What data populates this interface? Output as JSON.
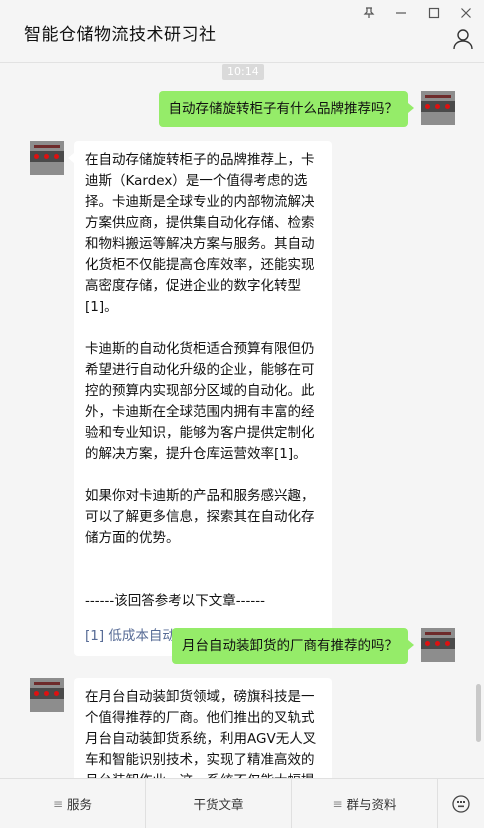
{
  "window": {
    "title": "智能仓储物流技术研习社",
    "pin_glyph": "⊥",
    "minimize_glyph": "—",
    "maximize_glyph": "☐",
    "close_glyph": "✕"
  },
  "chat": {
    "timestamp": "10:14",
    "messages": [
      {
        "role": "user",
        "text": "自动存储旋转柜子有什么品牌推荐吗？"
      },
      {
        "role": "bot",
        "paragraphs": [
          "在自动存储旋转柜子的品牌推荐上，卡迪斯（Kardex）是一个值得考虑的选择。卡迪斯是全球专业的内部物流解决方案供应商，提供集自动化存储、检索和物料搬运等解决方案与服务。其自动化货柜不仅能提高仓库效率，还能实现高密度存储，促进企业的数字化转型[1]。",
          "卡迪斯的自动化货柜适合预算有限但仍希望进行自动化升级的企业，能够在可控的预算内实现部分区域的自动化。此外，卡迪斯在全球范围内拥有丰富的经验和专业知识，能够为客户提供定制化的解决方案，提升仓库运营效率[1]。",
          "如果你对卡迪斯的产品和服务感兴趣，可以了解更多信息，探索其在自动化存储方面的优势。"
        ],
        "ref_header": "------该回答参考以下文章------",
        "ref_link": "[1] 低成本自动化：仓库升..."
      },
      {
        "role": "user",
        "text": "月台自动装卸货的厂商有推荐的吗？"
      },
      {
        "role": "bot",
        "paragraphs": [
          "在月台自动装卸货领域，磅旗科技是一个值得推荐的厂商。他们推出的叉轨式月台自动装卸货系统，利用AGV无人叉车和智能识别技术，实现了精准高效的月台装卸作业。这一系统不仅能大幅提"
        ]
      }
    ]
  },
  "menu": {
    "items": [
      {
        "label": "服务",
        "has_menu_icon": true
      },
      {
        "label": "干货文章",
        "has_menu_icon": false
      },
      {
        "label": "群与资料",
        "has_menu_icon": true
      }
    ],
    "keyboard_icon": "keyboard-toggle-icon"
  }
}
